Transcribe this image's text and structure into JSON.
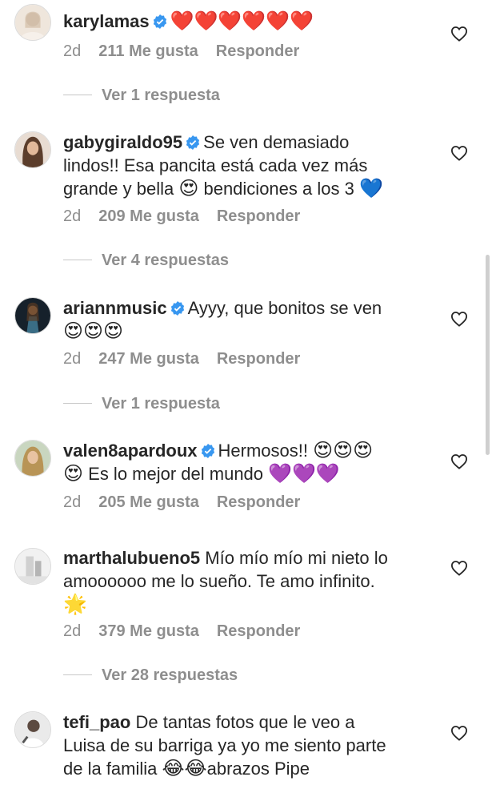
{
  "comments": [
    {
      "username": "karylamas",
      "verified": true,
      "text": "",
      "emojis": "❤️❤️❤️❤️❤️❤️",
      "time": "2d",
      "likes": "211 Me gusta",
      "reply": "Responder",
      "replies": "Ver 1 respuesta",
      "avatar_color": "#d9c7b8"
    },
    {
      "username": "gabygiraldo95",
      "verified": true,
      "line1": "Se ven demasiado",
      "line2": "lindos!! Esa pancita está cada vez más",
      "line3a": "grande y bella ",
      "line3emoji": "😍",
      "line3b": " bendiciones a los 3 ",
      "line3emoji2": "💙",
      "time": "2d",
      "likes": "209 Me gusta",
      "reply": "Responder",
      "replies": "Ver 4 respuestas",
      "avatar_color": "#7a5a44"
    },
    {
      "username": "ariannmusic",
      "verified": true,
      "line1": "Ayyy, que bonitos se ven",
      "line2emoji": "😍😍😍",
      "time": "2d",
      "likes": "247 Me gusta",
      "reply": "Responder",
      "replies": "Ver 1 respuesta",
      "avatar_color": "#1f3b4d"
    },
    {
      "username": "valen8apardoux",
      "verified": true,
      "line1": "Hermosos!! ",
      "line1emoji": "😍😍😍",
      "line2emoji": "😍",
      "line2text": " Es lo mejor del mundo ",
      "line2emoji2": "💜💜💜",
      "time": "2d",
      "likes": "205 Me gusta",
      "reply": "Responder",
      "avatar_color": "#a69466"
    },
    {
      "username": "marthalubueno5",
      "verified": false,
      "line1": "Mío mío mío mi nieto lo",
      "line2": "amoooooo me lo sueño. Te amo infinito.",
      "line3emoji": "🌟",
      "time": "2d",
      "likes": "379 Me gusta",
      "reply": "Responder",
      "replies": "Ver 28 respuestas",
      "avatar_color": "#bcbcbc"
    },
    {
      "username": "tefi_pao",
      "verified": false,
      "line1": "De tantas fotos que le veo a",
      "line2": "Luisa de su barriga ya yo me siento parte",
      "line3a": "de la familia ",
      "line3emoji": "😂😂",
      "line3b": "abrazos Pipe",
      "avatar_color": "#8c8c8c"
    }
  ],
  "icons": {
    "like": "heart-outline-icon",
    "verified": "verified-badge-icon"
  },
  "colors": {
    "text": "#262626",
    "meta": "#8e8e8e",
    "verified": "#3897f0"
  }
}
